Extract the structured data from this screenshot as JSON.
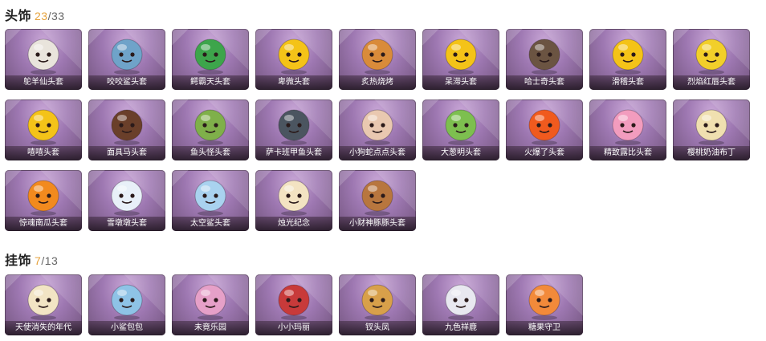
{
  "headwear": {
    "title": "头饰",
    "owned": "23",
    "total": "33",
    "items": [
      {
        "label": "鸵羊仙头套",
        "icon": "sheep-mask-icon",
        "color": "#e9e4dc"
      },
      {
        "label": "咬咬鲨头套",
        "icon": "shark-mask-icon",
        "color": "#6fa3c9"
      },
      {
        "label": "鳄霸天头套",
        "icon": "crocodile-mask-icon",
        "color": "#3da54b"
      },
      {
        "label": "卑微头套",
        "icon": "emoji-humble-icon",
        "color": "#f4c318"
      },
      {
        "label": "炙热烧烤",
        "icon": "bbq-meat-icon",
        "color": "#d98b3a"
      },
      {
        "label": "呆滞头套",
        "icon": "emoji-dazed-icon",
        "color": "#f4c318"
      },
      {
        "label": "哈士奇头套",
        "icon": "husky-mask-icon",
        "color": "#6b5442"
      },
      {
        "label": "滑稽头套",
        "icon": "emoji-funny-icon",
        "color": "#f4c318"
      },
      {
        "label": "烈焰红唇头套",
        "icon": "pikachu-mask-icon",
        "color": "#f2cf2a"
      },
      {
        "label": "嘻嘻头套",
        "icon": "emoji-grin-icon",
        "color": "#f4c318"
      },
      {
        "label": "面具马头套",
        "icon": "horse-mask-icon",
        "color": "#6a3f2a"
      },
      {
        "label": "鱼头怪头套",
        "icon": "fish-monster-mask-icon",
        "color": "#7fb04a"
      },
      {
        "label": "萨卡班甲鱼头套",
        "icon": "sacabambaspis-mask-icon",
        "color": "#4b5560"
      },
      {
        "label": "小狗蛇点点头套",
        "icon": "dog-snake-mask-icon",
        "color": "#e9c8b0"
      },
      {
        "label": "大葱明头套",
        "icon": "scallion-mask-icon",
        "color": "#7dbf4f"
      },
      {
        "label": "火爆了头套",
        "icon": "fire-mask-icon",
        "color": "#f05a1e"
      },
      {
        "label": "精致露比头套",
        "icon": "pink-pig-mask-icon",
        "color": "#f29cbe"
      },
      {
        "label": "樱桃奶油布丁",
        "icon": "pudding-mask-icon",
        "color": "#f0e0b0"
      },
      {
        "label": "惊魂南瓜头套",
        "icon": "pumpkin-mask-icon",
        "color": "#f28a1e"
      },
      {
        "label": "雪墩墩头套",
        "icon": "snowman-mask-icon",
        "color": "#e8f0f8"
      },
      {
        "label": "太空鲨头套",
        "icon": "space-shark-mask-icon",
        "color": "#a9d2ef"
      },
      {
        "label": "烛光纪念",
        "icon": "candle-icon",
        "color": "#f3e3c2"
      },
      {
        "label": "小财神豚豚头套",
        "icon": "capybara-mask-icon",
        "color": "#b8763e"
      }
    ]
  },
  "pendants": {
    "title": "挂饰",
    "owned": "7",
    "total": "13",
    "items": [
      {
        "label": "天使消失的年代",
        "icon": "angel-pendant-icon",
        "color": "#f2e4c4"
      },
      {
        "label": "小鲨包包",
        "icon": "shark-bag-pendant-icon",
        "color": "#8ec3e6"
      },
      {
        "label": "未竟乐园",
        "icon": "paradise-doll-pendant-icon",
        "color": "#e6a0c8"
      },
      {
        "label": "小小玛丽",
        "icon": "mary-doll-pendant-icon",
        "color": "#c83a3a"
      },
      {
        "label": "钗头凤",
        "icon": "phoenix-hairpin-pendant-icon",
        "color": "#d8a04a"
      },
      {
        "label": "九色祥鹿",
        "icon": "deer-pendant-icon",
        "color": "#e8e8f0"
      },
      {
        "label": "糖果守卫",
        "icon": "candy-guard-pendant-icon",
        "color": "#f28a3a"
      }
    ]
  }
}
